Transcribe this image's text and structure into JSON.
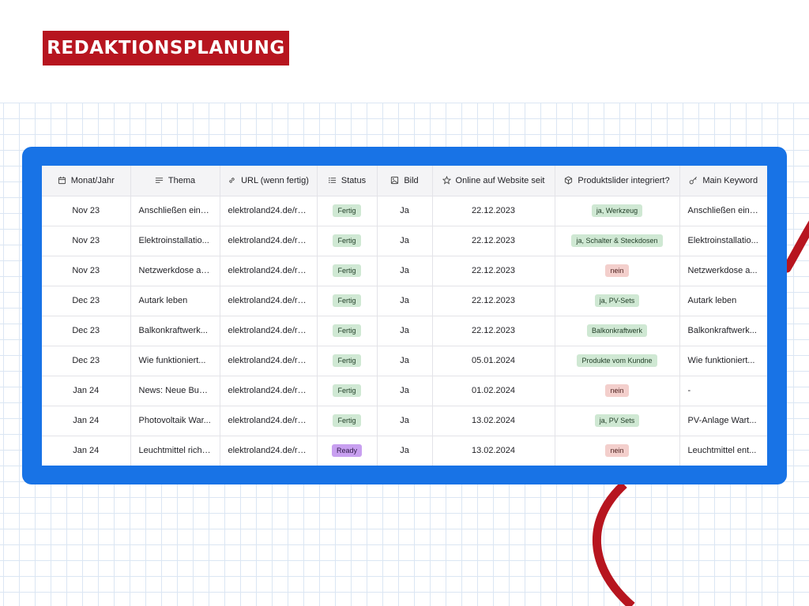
{
  "title": "REDAKTIONSPLANUNG",
  "colors": {
    "brand_red": "#b7151f",
    "panel_blue": "#1873e6",
    "badge_green": "#cfe8d3",
    "badge_purple": "#c89ff0",
    "badge_red": "#f3cfcc"
  },
  "table": {
    "columns": [
      {
        "label": "Monat/Jahr",
        "icon": "calendar-icon"
      },
      {
        "label": "Thema",
        "icon": "text-lines-icon"
      },
      {
        "label": "URL (wenn fertig)",
        "icon": "link-icon"
      },
      {
        "label": "Status",
        "icon": "list-icon"
      },
      {
        "label": "Bild",
        "icon": "image-icon"
      },
      {
        "label": "Online auf Website seit",
        "icon": "star-icon"
      },
      {
        "label": "Produktslider integriert?",
        "icon": "cube-icon"
      },
      {
        "label": "Main Keyword",
        "icon": "key-icon"
      }
    ],
    "rows": [
      {
        "month": "Nov 23",
        "topic": "Anschließen eine...",
        "url": "elektroland24.de/ra...",
        "status": "Fertig",
        "status_color": "green",
        "image": "Ja",
        "online": "22.12.2023",
        "slider": "ja, Werkzeug",
        "slider_color": "green",
        "keyword": "Anschließen eine..."
      },
      {
        "month": "Nov 23",
        "topic": "Elektroinstallatio...",
        "url": "elektroland24.de/ra...",
        "status": "Fertig",
        "status_color": "green",
        "image": "Ja",
        "online": "22.12.2023",
        "slider": "ja, Schalter & Steckdosen",
        "slider_color": "green",
        "keyword": "Elektroinstallatio..."
      },
      {
        "month": "Nov 23",
        "topic": "Netzwerkdose an...",
        "url": "elektroland24.de/ra...",
        "status": "Fertig",
        "status_color": "green",
        "image": "Ja",
        "online": "22.12.2023",
        "slider": "nein",
        "slider_color": "red",
        "keyword": "Netzwerkdose a..."
      },
      {
        "month": "Dec 23",
        "topic": "Autark leben",
        "url": "elektroland24.de/ra...",
        "status": "Fertig",
        "status_color": "green",
        "image": "Ja",
        "online": "22.12.2023",
        "slider": "ja, PV-Sets",
        "slider_color": "green",
        "keyword": "Autark leben"
      },
      {
        "month": "Dec 23",
        "topic": "Balkonkraftwerk...",
        "url": "elektroland24.de/ra...",
        "status": "Fertig",
        "status_color": "green",
        "image": "Ja",
        "online": "22.12.2023",
        "slider": "Balkonkraftwerk",
        "slider_color": "green",
        "keyword": "Balkonkraftwerk..."
      },
      {
        "month": "Dec 23",
        "topic": "Wie funktioniert...",
        "url": "elektroland24.de/ra...",
        "status": "Fertig",
        "status_color": "green",
        "image": "Ja",
        "online": "05.01.2024",
        "slider": "Produkte vom Kundne",
        "slider_color": "green",
        "keyword": "Wie funktioniert..."
      },
      {
        "month": "Jan 24",
        "topic": "News: Neue Busc...",
        "url": "elektroland24.de/ra...",
        "status": "Fertig",
        "status_color": "green",
        "image": "Ja",
        "online": "01.02.2024",
        "slider": "nein",
        "slider_color": "red",
        "keyword": "-"
      },
      {
        "month": "Jan 24",
        "topic": "Photovoltaik War...",
        "url": "elektroland24.de/ra...",
        "status": "Fertig",
        "status_color": "green",
        "image": "Ja",
        "online": "13.02.2024",
        "slider": "ja, PV Sets",
        "slider_color": "green",
        "keyword": "PV-Anlage Wart..."
      },
      {
        "month": "Jan 24",
        "topic": "Leuchtmittel richt...",
        "url": "elektroland24.de/ra...",
        "status": "Ready",
        "status_color": "purple",
        "image": "Ja",
        "online": "13.02.2024",
        "slider": "nein",
        "slider_color": "red",
        "keyword": "Leuchtmittel ent..."
      }
    ]
  }
}
